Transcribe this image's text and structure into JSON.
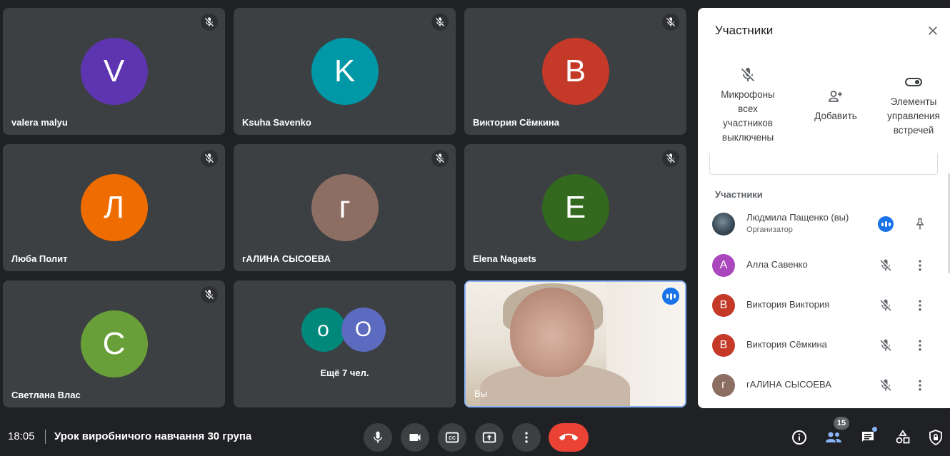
{
  "tiles": [
    {
      "name": "valera malyu",
      "initial": "V",
      "color": "#5e35b1"
    },
    {
      "name": "Ksuha Savenko",
      "initial": "K",
      "color": "#0097a7"
    },
    {
      "name": "Виктория Сёмкина",
      "initial": "В",
      "color": "#c53929"
    },
    {
      "name": "Люба Полит",
      "initial": "Л",
      "color": "#ef6c00"
    },
    {
      "name": "гАЛИНА СЫСОЕВА",
      "initial": "г",
      "color": "#8d6e63"
    },
    {
      "name": "Elena Nagaets",
      "initial": "E",
      "color": "#33691e"
    },
    {
      "name": "Светлана Влас",
      "initial": "C",
      "color": "#689f38"
    }
  ],
  "more_tile": {
    "avatar1": {
      "initial": "о",
      "color": "#00897b"
    },
    "avatar2": {
      "initial": "O",
      "color": "#5c6bc0"
    },
    "label": "Ещё 7 чел."
  },
  "self_tile": {
    "label": "Вы"
  },
  "panel": {
    "title": "Участники",
    "actions": {
      "mute_all": "Микрофоны всех участников выключены",
      "add": "Добавить",
      "controls": "Элементы управления встречей"
    },
    "section_label": "Участники",
    "participants": [
      {
        "name": "Людмила Пащенко (вы)",
        "role": "Организатор",
        "initial": ""
      },
      {
        "name": "Алла Савенко",
        "initial": "А",
        "color": "#ab47bc"
      },
      {
        "name": "Виктория Виктория",
        "initial": "В",
        "color": "#c53929"
      },
      {
        "name": "Виктория Сёмкина",
        "initial": "В",
        "color": "#c53929"
      },
      {
        "name": "гАЛИНА СЫСОЕВА",
        "initial": "г",
        "color": "#8d6e63"
      }
    ]
  },
  "bottom_bar": {
    "time": "18:05",
    "meeting_title": "Урок виробничого навчання 30 група",
    "participant_count": "15"
  },
  "colors": {
    "background": "#202124",
    "tile": "#3c4043",
    "accent": "#1a73e8",
    "end_call": "#ea4335"
  }
}
